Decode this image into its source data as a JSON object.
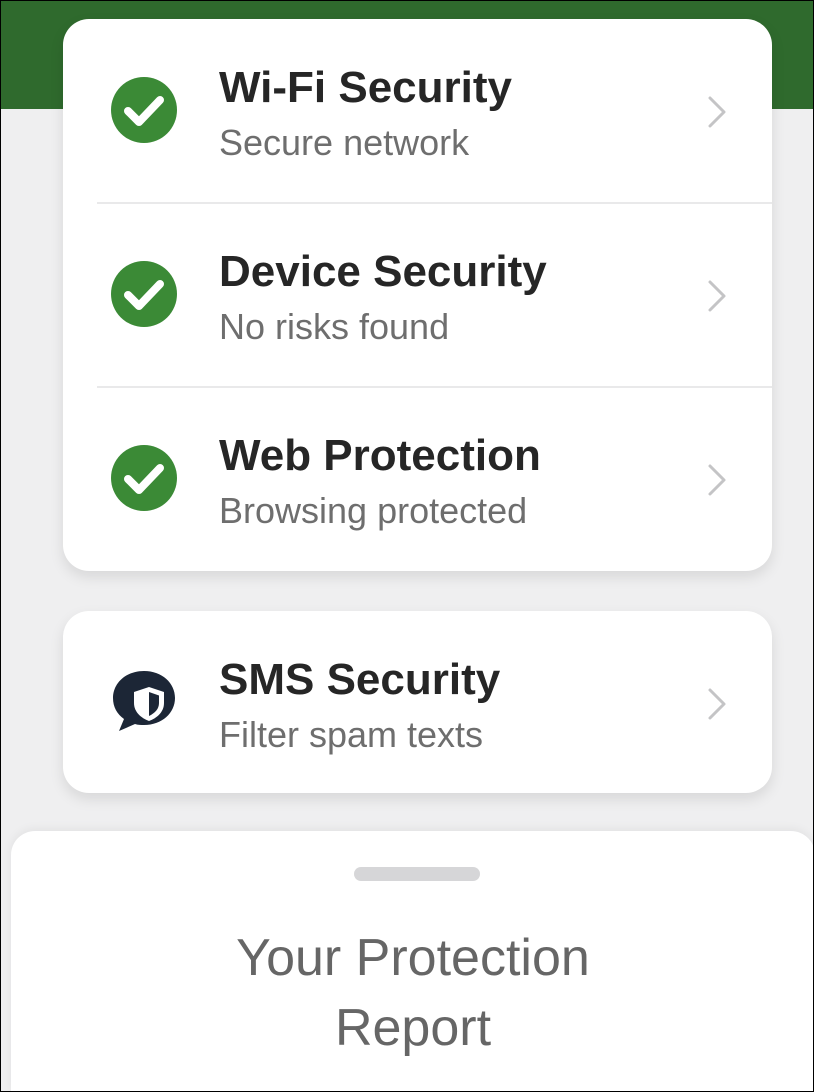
{
  "colors": {
    "header_green": "#2f6a2d",
    "check_green": "#3b8a36",
    "sms_icon_navy": "#1c2636"
  },
  "security_items": [
    {
      "title": "Wi-Fi Security",
      "subtitle": "Secure network",
      "icon": "check-circle-icon",
      "status": "ok"
    },
    {
      "title": "Device Security",
      "subtitle": "No risks found",
      "icon": "check-circle-icon",
      "status": "ok"
    },
    {
      "title": "Web Protection",
      "subtitle": "Browsing protected",
      "icon": "check-circle-icon",
      "status": "ok"
    }
  ],
  "sms_item": {
    "title": "SMS Security",
    "subtitle": "Filter spam texts",
    "icon": "chat-shield-icon"
  },
  "report_sheet": {
    "title": "Your Protection Report"
  }
}
